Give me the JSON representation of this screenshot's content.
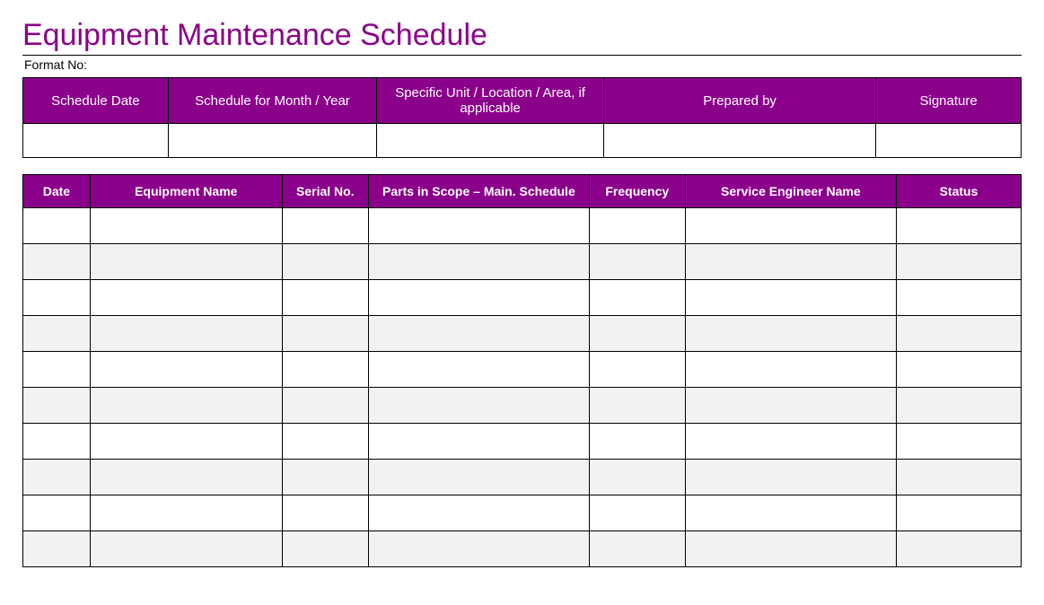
{
  "title": "Equipment Maintenance Schedule",
  "format_no_label": "Format No:",
  "header_table": {
    "columns": [
      "Schedule Date",
      "Schedule for Month / Year",
      "Specific Unit / Location  / Area, if applicable",
      "Prepared  by",
      "Signature"
    ],
    "row": [
      "",
      "",
      "",
      "",
      ""
    ]
  },
  "main_table": {
    "columns": [
      "Date",
      "Equipment Name",
      "Serial No.",
      "Parts in Scope – Main. Schedule",
      "Frequency",
      "Service Engineer Name",
      "Status"
    ],
    "rows": [
      [
        "",
        "",
        "",
        "",
        "",
        "",
        ""
      ],
      [
        "",
        "",
        "",
        "",
        "",
        "",
        ""
      ],
      [
        "",
        "",
        "",
        "",
        "",
        "",
        ""
      ],
      [
        "",
        "",
        "",
        "",
        "",
        "",
        ""
      ],
      [
        "",
        "",
        "",
        "",
        "",
        "",
        ""
      ],
      [
        "",
        "",
        "",
        "",
        "",
        "",
        ""
      ],
      [
        "",
        "",
        "",
        "",
        "",
        "",
        ""
      ],
      [
        "",
        "",
        "",
        "",
        "",
        "",
        ""
      ],
      [
        "",
        "",
        "",
        "",
        "",
        "",
        ""
      ],
      [
        "",
        "",
        "",
        "",
        "",
        "",
        ""
      ]
    ]
  }
}
